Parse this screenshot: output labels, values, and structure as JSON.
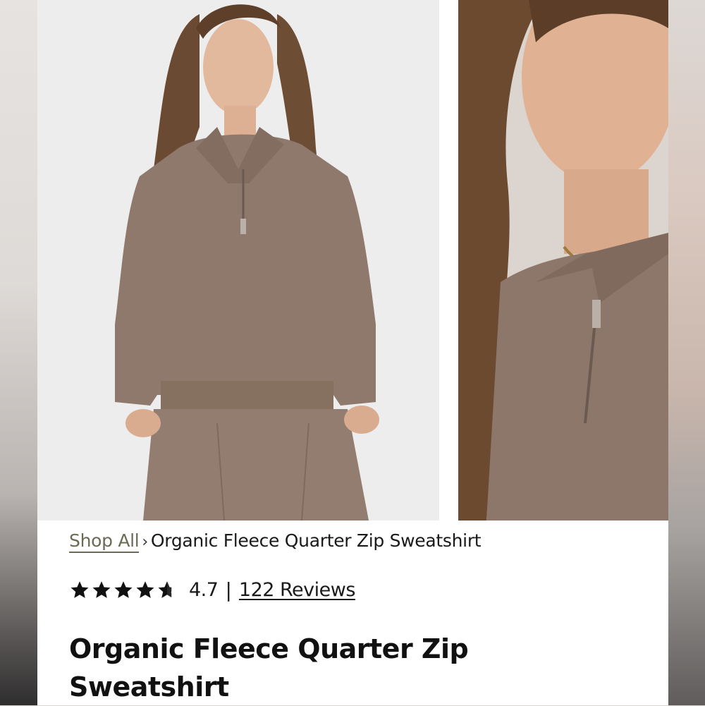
{
  "gallery": {
    "images": [
      {
        "alt": "model-full-front"
      },
      {
        "alt": "model-closeup-zip"
      }
    ]
  },
  "breadcrumb": {
    "root_label": "Shop All",
    "separator": "›",
    "current_label": "Organic Fleece Quarter Zip Sweatshirt"
  },
  "rating": {
    "stars": 4.5,
    "value": "4.7",
    "divider": "|",
    "reviews_label": "122 Reviews"
  },
  "product": {
    "title": "Organic Fleece Quarter Zip Sweatshirt"
  },
  "colors": {
    "garment": "#8f786c",
    "breadcrumb_link": "#6b6b55",
    "text": "#111111"
  }
}
